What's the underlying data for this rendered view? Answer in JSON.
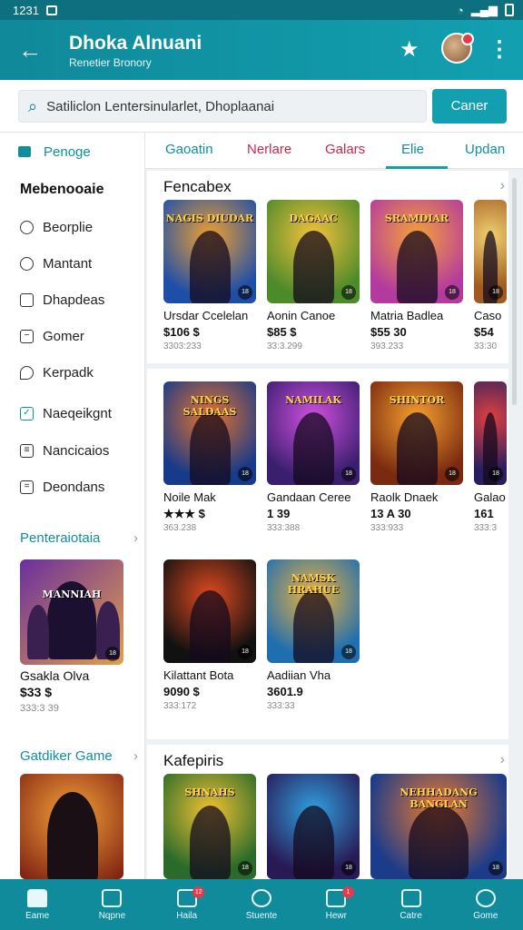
{
  "status": {
    "time": "1231"
  },
  "appbar": {
    "title": "Dhoka Alnuani",
    "subtitle": "Renetier Bronory"
  },
  "search": {
    "value": "Satiliclon Lentersinularlet, Dhoplaanai",
    "button": "Caner"
  },
  "sidebar": {
    "active": "Penoge",
    "heading": "Mebenooaie",
    "items": [
      {
        "label": "Beorplie",
        "icon": "clock-icon"
      },
      {
        "label": "Mantant",
        "icon": "timer-icon"
      },
      {
        "label": "Dhapdeas",
        "icon": "square-icon"
      },
      {
        "label": "Gomer",
        "icon": "minus-box-icon"
      },
      {
        "label": "Kerpadk",
        "icon": "pin-icon"
      },
      {
        "label": "Naeqeikgnt",
        "icon": "checkbox-icon"
      },
      {
        "label": "Nancicaios",
        "icon": "list-icon"
      },
      {
        "label": "Deondans",
        "icon": "stack-icon"
      }
    ],
    "section1": "Penteraiotaia",
    "card1": {
      "title": "Gsakla Olva",
      "price": "$33 $",
      "meta": "333:3 39"
    },
    "section2": "Gatdiker Game"
  },
  "tabs": [
    "Gaoatin",
    "Nerlare",
    "Galars",
    "Elie",
    "Updan"
  ],
  "featured": {
    "title": "Fencabex",
    "cards": [
      {
        "title": "Ursdar Ccelelan",
        "price": "$106 $",
        "meta": "3303:233",
        "art": "NAGIS DIUDAR",
        "c1": "#1e4fa8",
        "c2": "#f0a030"
      },
      {
        "title": "Aonin Canoe",
        "price": "$85 $",
        "meta": "33:3.299",
        "art": "DAGAAC",
        "c1": "#4d8a2a",
        "c2": "#f5c23c"
      },
      {
        "title": "Matria Badlea",
        "price": "$55 30",
        "meta": "393.233",
        "art": "SRAMDIAR",
        "c1": "#b33a9e",
        "c2": "#f6a13a"
      },
      {
        "title": "Caso",
        "price": "$54",
        "meta": "33:30",
        "art": "",
        "c1": "#a05a20",
        "c2": "#f0d070"
      }
    ]
  },
  "grid": {
    "cards": [
      {
        "title": "Noile Mak",
        "price": "★★★ $",
        "meta": "363.238",
        "art": "NINGS SALDAAS",
        "c1": "#173a8a",
        "c2": "#e9742a"
      },
      {
        "title": "Gandaan Ceree",
        "price": "1 39",
        "meta": "333:388",
        "art": "NAMILAK",
        "c1": "#3a1f6e",
        "c2": "#d14fe0"
      },
      {
        "title": "Raolk Dnaek",
        "price": "13 A 30",
        "meta": "333:933",
        "art": "SHINTOR",
        "c1": "#7a2a10",
        "c2": "#f5a030"
      },
      {
        "title": "Galao",
        "price": "161",
        "meta": "333:3",
        "art": "",
        "c1": "#2a1f5e",
        "c2": "#e04040"
      },
      {
        "title": "Kilattant Bota",
        "price": "9090 $",
        "meta": "333:172",
        "art": "",
        "c1": "#111111",
        "c2": "#e04a20"
      },
      {
        "title": "Aadiian Vha",
        "price": "3601.9",
        "meta": "333:33",
        "art": "NAMSK HRAHUE",
        "c1": "#1f6fb0",
        "c2": "#f2b23a"
      }
    ]
  },
  "section2": {
    "title": "Kafepiris",
    "cards": [
      {
        "art": "SHNAHS",
        "c1": "#2a6a2a",
        "c2": "#f1c232"
      },
      {
        "art": "",
        "c1": "#281a55",
        "c2": "#30a0e0"
      },
      {
        "art": "NEHHADANG BANGLAN",
        "c1": "#1c3c8a",
        "c2": "#f07a2a"
      }
    ]
  },
  "bottomnav": [
    {
      "label": "Eame",
      "badge": ""
    },
    {
      "label": "Nqpne",
      "badge": ""
    },
    {
      "label": "Haila",
      "badge": "12"
    },
    {
      "label": "Stuente",
      "badge": ""
    },
    {
      "label": "Hewr",
      "badge": "1"
    },
    {
      "label": "Catre",
      "badge": ""
    },
    {
      "label": "Gome",
      "badge": ""
    }
  ]
}
